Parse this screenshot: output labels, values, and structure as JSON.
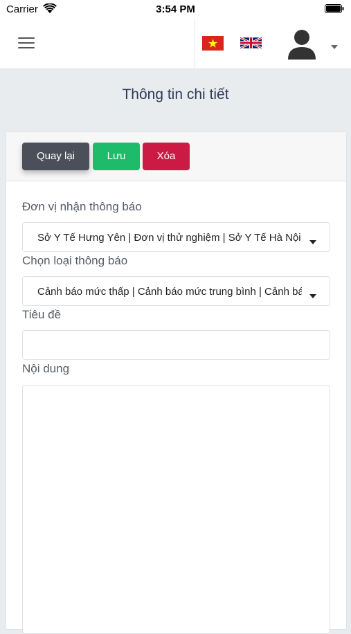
{
  "status_bar": {
    "carrier": "Carrier",
    "time": "3:54 PM"
  },
  "navbar": {
    "menu_icon": "hamburger-icon",
    "languages": [
      "vn-flag-icon",
      "gb-flag-icon"
    ],
    "user_icon": "user-avatar-icon"
  },
  "page": {
    "title": "Thông tin chi tiết"
  },
  "toolbar": {
    "back_label": "Quay lại",
    "save_label": "Lưu",
    "delete_label": "Xóa"
  },
  "form": {
    "recipient_label": "Đơn vị nhận thông báo",
    "recipient_value": "Sở Y Tế Hưng Yên | Đơn vị thử nghiệm | Sở Y Tế Hà Nội",
    "type_label": "Chọn loại thông báo",
    "type_value": "Cảnh báo mức thấp | Cảnh báo mức trung bình | Cảnh báo",
    "title_label": "Tiêu đề",
    "title_value": "",
    "content_label": "Nội dung",
    "content_value": ""
  },
  "colors": {
    "back_button": "#4b4f59",
    "save_button": "#1ebc6a",
    "delete_button": "#cb1b45",
    "page_background": "#e9ecef"
  }
}
